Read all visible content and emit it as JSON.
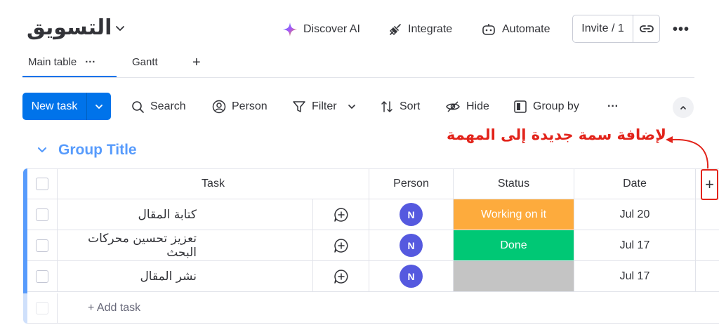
{
  "header": {
    "board_title": "التسويق",
    "discover_ai": "Discover AI",
    "integrate": "Integrate",
    "automate": "Automate",
    "invite": "Invite / 1",
    "more": "•••"
  },
  "tabs": {
    "main_table": "Main table",
    "main_table_more": "···",
    "gantt": "Gantt",
    "add": "+"
  },
  "toolbar": {
    "new_task": "New task",
    "search": "Search",
    "person": "Person",
    "filter": "Filter",
    "sort": "Sort",
    "hide": "Hide",
    "group_by": "Group by",
    "more": "···"
  },
  "group": {
    "title": "Group Title"
  },
  "annotation": {
    "text": "لإضافة سمة جديدة إلى المهمة",
    "color": "#e2231a"
  },
  "table": {
    "columns": {
      "task": "Task",
      "person": "Person",
      "status": "Status",
      "date": "Date",
      "add": "+"
    },
    "rows": [
      {
        "task": "كتابة المقال",
        "person_initial": "N",
        "status": "Working on it",
        "status_color": "#fdab3d",
        "date": "Jul 20"
      },
      {
        "task": "تعزيز تحسين محركات البحث",
        "person_initial": "N",
        "status": "Done",
        "status_color": "#00c875",
        "date": "Jul 17"
      },
      {
        "task": "نشر المقال",
        "person_initial": "N",
        "status": "",
        "status_color": "#c4c4c4",
        "date": "Jul 17"
      }
    ],
    "add_task": "+ Add task"
  },
  "colors": {
    "accent": "#0073ea",
    "group": "#579bfc",
    "avatar": "#5559df"
  }
}
